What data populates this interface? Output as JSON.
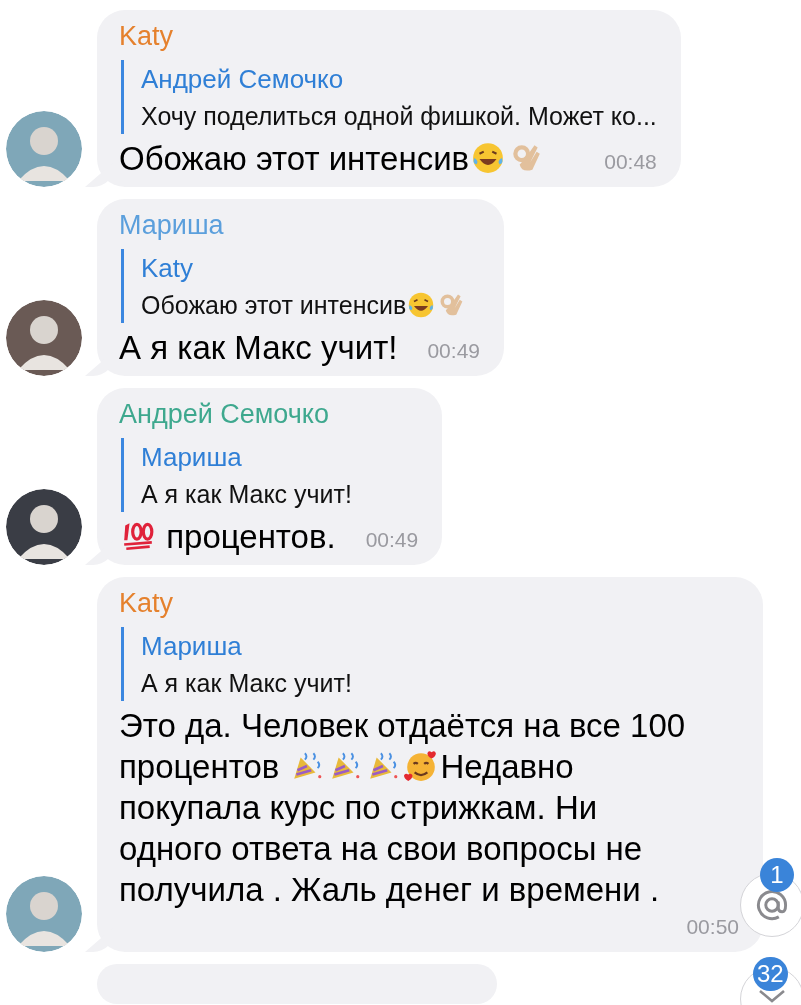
{
  "messages": [
    {
      "sender": "Katy",
      "color": "#e5812d",
      "avatar": {
        "color": "#7fa7b8"
      },
      "reply": {
        "name": "Андрей Семочко",
        "text": "Хочу поделиться одной фишкой. Может ко..."
      },
      "body": [
        {
          "kind": "text",
          "text": "Обожаю этот интенсив"
        },
        {
          "kind": "laugh"
        },
        {
          "kind": "ok"
        }
      ],
      "time": "00:48"
    },
    {
      "sender": "Мариша",
      "color": "#5b9fdc",
      "avatar": {
        "color": "#6a5a55"
      },
      "reply": {
        "name": "Katy",
        "text": "Обожаю этот интенсив",
        "emojis": [
          {
            "kind": "laugh"
          },
          {
            "kind": "ok"
          }
        ]
      },
      "body": [
        {
          "kind": "text",
          "text": "А я как Макс учит!"
        }
      ],
      "time": "00:49"
    },
    {
      "sender": "Андрей Семочко",
      "color": "#3ea88e",
      "avatar": {
        "color": "#3a3d45"
      },
      "reply": {
        "name": "Мариша",
        "text": "А я как Макс учит!"
      },
      "body": [
        {
          "kind": "hundred"
        },
        {
          "kind": "text",
          "text": " процентов."
        }
      ],
      "time": "00:49"
    },
    {
      "sender": "Katy",
      "color": "#e5812d",
      "avatar": {
        "color": "#7fa7b8"
      },
      "reply": {
        "name": "Мариша",
        "text": "А я как Макс учит!"
      },
      "body": [
        {
          "kind": "text",
          "text": "Это да. Человек отдаётся на все 100 процентов "
        },
        {
          "kind": "party"
        },
        {
          "kind": "party"
        },
        {
          "kind": "party"
        },
        {
          "kind": "hearts"
        },
        {
          "kind": "text",
          "text": "Недавно покупала курс по стрижкам. Ни одного ответа на свои вопросы не получила . Жаль денег и времени ."
        }
      ],
      "time": "00:50"
    }
  ],
  "mentions_button": {
    "badge": "1"
  },
  "scroll_down_button": {
    "badge": "32"
  }
}
